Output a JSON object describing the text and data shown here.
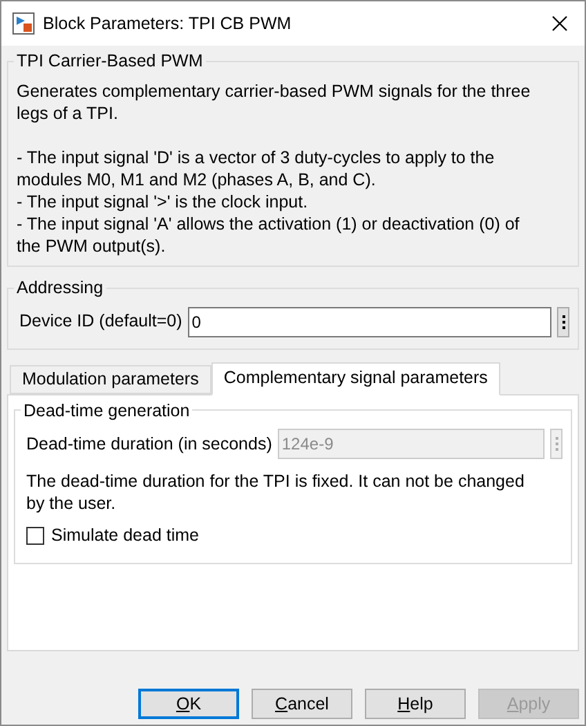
{
  "window": {
    "title": "Block Parameters: TPI CB PWM"
  },
  "description": {
    "title": "TPI Carrier-Based PWM",
    "paragraphs": [
      "Generates complementary carrier-based PWM signals for the three legs of a TPI.",
      "- The input signal 'D' is a vector of 3 duty-cycles to apply to the modules M0, M1 and M2 (phases A, B, and C).",
      "- The input signal '>' is the clock input.",
      "- The input signal 'A' allows the activation (1) or deactivation (0) of the PWM output(s)."
    ]
  },
  "addressing": {
    "title": "Addressing",
    "fields": [
      {
        "label": "Device ID (default=0)",
        "value": "0",
        "disabled": false
      }
    ]
  },
  "tabs": [
    {
      "label": "Modulation parameters",
      "selected": false
    },
    {
      "label": "Complementary signal parameters",
      "selected": true
    }
  ],
  "dead_time": {
    "title": "Dead-time generation",
    "fields": [
      {
        "label": "Dead-time duration (in seconds)",
        "value": "124e-9",
        "disabled": true
      }
    ],
    "note": "The dead-time duration for the TPI is fixed. It can not be changed by the user.",
    "checkbox": {
      "label": "Simulate dead time",
      "checked": false
    }
  },
  "buttons": [
    {
      "label": "OK",
      "default": true,
      "disabled": false
    },
    {
      "label": "Cancel",
      "default": false,
      "disabled": false
    },
    {
      "label": "Help",
      "default": false,
      "disabled": false
    },
    {
      "label": "Apply",
      "default": false,
      "disabled": true
    }
  ]
}
